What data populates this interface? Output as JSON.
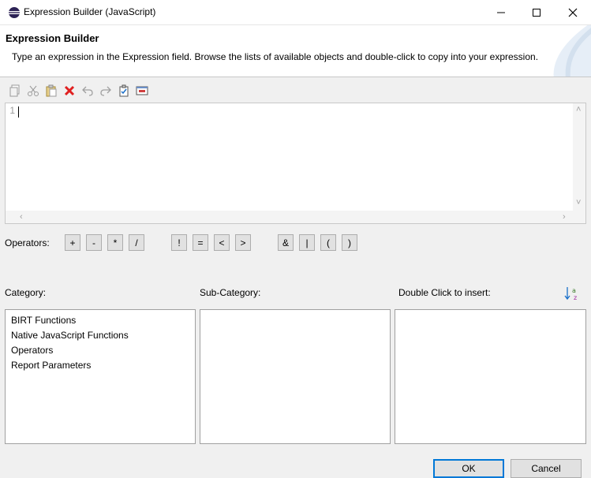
{
  "window": {
    "title": "Expression Builder (JavaScript)",
    "minimize_icon": "minimize-icon",
    "maximize_icon": "maximize-icon",
    "close_icon": "close-icon"
  },
  "banner": {
    "title": "Expression Builder",
    "description": "Type an expression in the Expression field. Browse the lists of available objects and double-click to copy into your expression."
  },
  "toolbar": {
    "icons": [
      "copy-icon",
      "cut-icon",
      "paste-icon",
      "delete-icon",
      "undo-icon",
      "redo-icon",
      "validate-icon",
      "preview-icon"
    ]
  },
  "editor": {
    "line_numbers": [
      "1"
    ],
    "content": ""
  },
  "operators": {
    "label": "Operators:",
    "buttons": [
      "+",
      "-",
      "*",
      "/",
      "!",
      "=",
      "<",
      ">",
      "&",
      "|",
      "(",
      ")"
    ]
  },
  "category": {
    "label": "Category:",
    "items": [
      "BIRT Functions",
      "Native JavaScript Functions",
      "Operators",
      "Report Parameters"
    ]
  },
  "subcategory": {
    "label": "Sub-Category:"
  },
  "insert": {
    "label": "Double Click to insert:",
    "sort_icon": "sort-alpha-icon"
  },
  "buttons": {
    "ok": "OK",
    "cancel": "Cancel"
  },
  "colors": {
    "accent": "#0078d7",
    "delete_red": "#e02020",
    "window_bg": "#f0f0f0"
  }
}
